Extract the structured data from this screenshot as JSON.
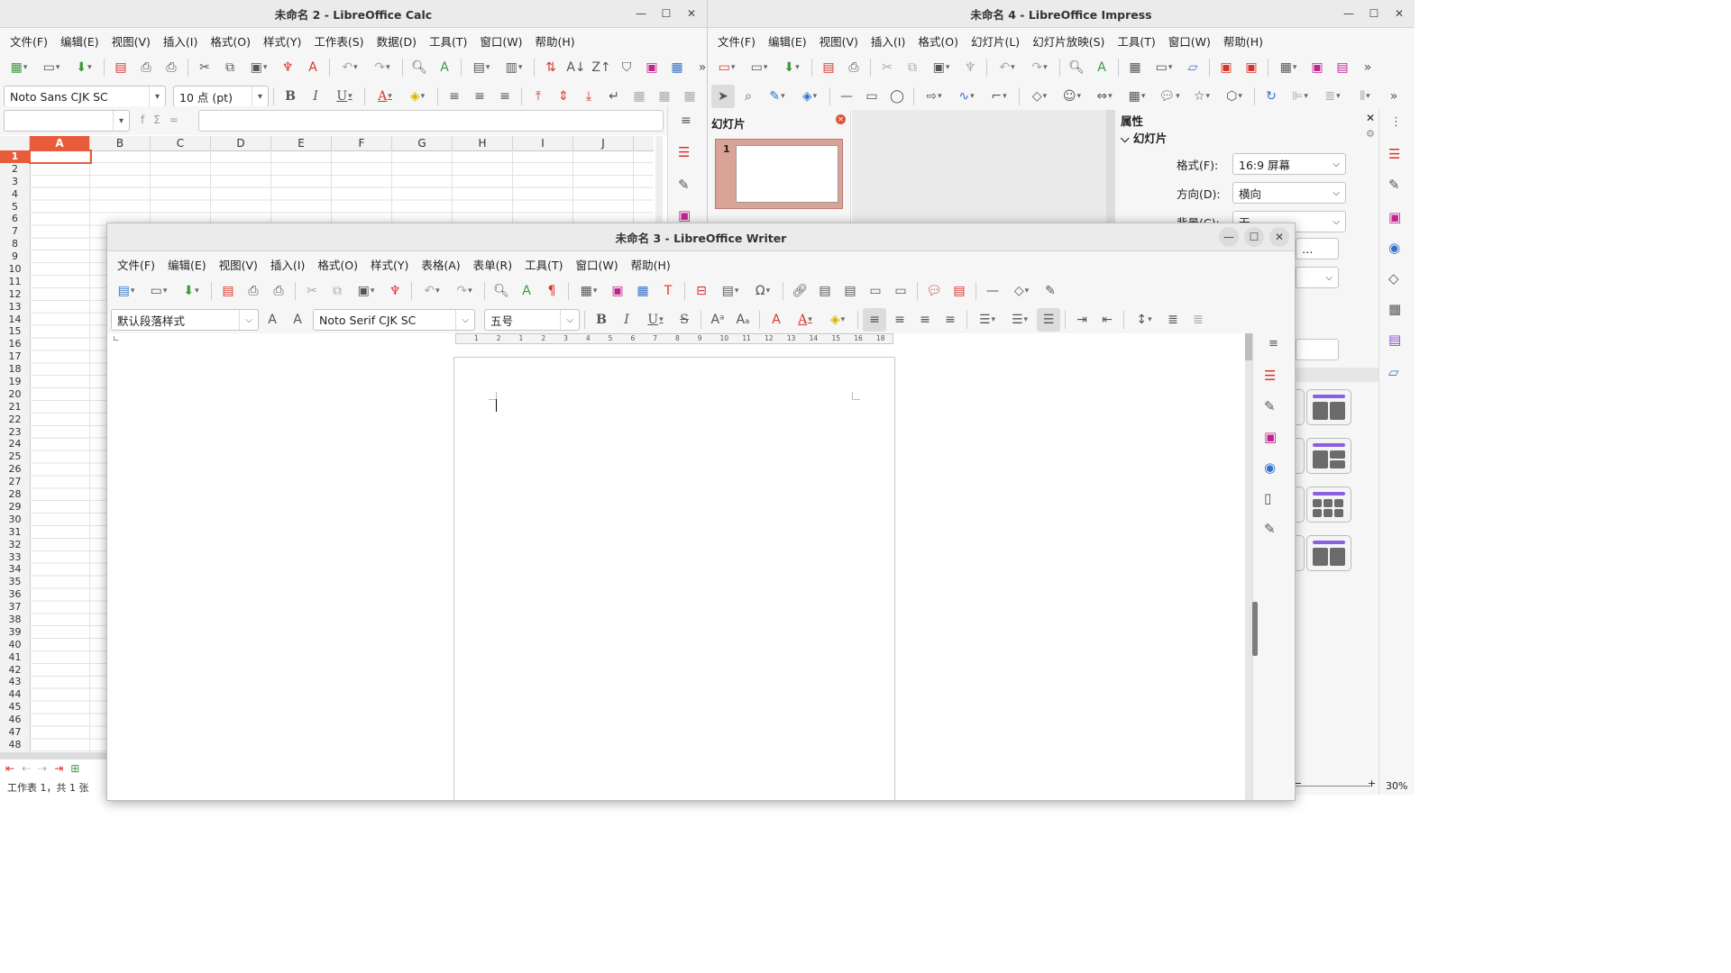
{
  "calc": {
    "title": "未命名 2 - LibreOffice Calc",
    "menu": [
      "文件(F)",
      "编辑(E)",
      "视图(V)",
      "插入(I)",
      "格式(O)",
      "样式(Y)",
      "工作表(S)",
      "数据(D)",
      "工具(T)",
      "窗口(W)",
      "帮助(H)"
    ],
    "font_name": "Noto Sans CJK SC",
    "font_size": "10 点 (pt)",
    "fx_icons": [
      "f",
      "Σ",
      "="
    ],
    "columns": [
      "A",
      "B",
      "C",
      "D",
      "E",
      "F",
      "G",
      "H",
      "I",
      "J"
    ],
    "rows": [
      "1",
      "2",
      "3",
      "4",
      "5",
      "6",
      "7",
      "8",
      "9",
      "10",
      "11",
      "12",
      "13",
      "14",
      "15",
      "16",
      "17",
      "18",
      "19",
      "20",
      "21",
      "22",
      "23",
      "24",
      "25",
      "26",
      "27",
      "28",
      "29",
      "30",
      "31",
      "32",
      "33",
      "34",
      "35",
      "36",
      "37",
      "38",
      "39",
      "40",
      "41",
      "42",
      "43",
      "44",
      "45",
      "46",
      "47",
      "48"
    ],
    "status": "工作表 1，共 1 张"
  },
  "impress": {
    "title": "未命名 4 - LibreOffice Impress",
    "menu": [
      "文件(F)",
      "编辑(E)",
      "视图(V)",
      "插入(I)",
      "格式(O)",
      "幻灯片(L)",
      "幻灯片放映(S)",
      "工具(T)",
      "窗口(W)",
      "帮助(H)"
    ],
    "slides_pane_title": "幻灯片",
    "slide_number": "1",
    "properties_title": "属性",
    "section_title": "幻灯片",
    "format_label": "格式(F):",
    "format_value": "16:9 屏幕",
    "orientation_label": "方向(D):",
    "orientation_value": "横向",
    "background_label": "背景(C):",
    "background_value": "无",
    "zoom": "30%"
  },
  "writer": {
    "title": "未命名 3 - LibreOffice Writer",
    "menu": [
      "文件(F)",
      "编辑(E)",
      "视图(V)",
      "插入(I)",
      "格式(O)",
      "样式(Y)",
      "表格(A)",
      "表单(R)",
      "工具(T)",
      "窗口(W)",
      "帮助(H)"
    ],
    "paragraph_style": "默认段落样式",
    "font_name": "Noto Serif CJK SC",
    "font_size": "五号",
    "ruler_marks": [
      "1",
      "2",
      "1",
      "2",
      "3",
      "4",
      "5",
      "6",
      "7",
      "8",
      "9",
      "10",
      "11",
      "12",
      "13",
      "14",
      "15",
      "16",
      "18"
    ]
  }
}
